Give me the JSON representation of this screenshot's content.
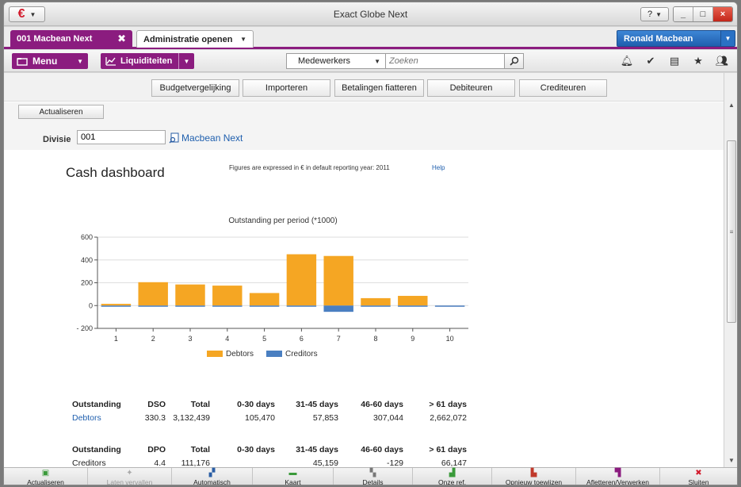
{
  "window": {
    "title": "Exact Globe Next",
    "help_label": "?",
    "controls": [
      "_",
      "□",
      "×"
    ]
  },
  "tabs": {
    "active_label": "001  Macbean Next",
    "second_label": "Administratie openen",
    "user_label": "Ronald Macbean"
  },
  "toolbar": {
    "menu_label": "Menu",
    "module_label": "Liquiditeiten",
    "search_scope": "Medewerkers",
    "search_placeholder": "Zoeken"
  },
  "topbuttons": [
    "Budgetvergelijking",
    "Importeren",
    "Betalingen fiatteren",
    "Debiteuren",
    "Crediteuren"
  ],
  "filter": {
    "refresh_label": "Actualiseren",
    "division_label": "Divisie",
    "division_value": "001",
    "division_link": "Macbean Next"
  },
  "dashboard": {
    "title": "Cash dashboard",
    "note": "Figures are expressed in € in default reporting year: 2011",
    "help": "Help"
  },
  "chart_data": {
    "type": "bar",
    "title": "Outstanding per period (*1000)",
    "categories": [
      "1",
      "2",
      "3",
      "4",
      "5",
      "6",
      "7",
      "8",
      "9",
      "10"
    ],
    "series": [
      {
        "name": "Debtors",
        "color": "#f5a623",
        "values": [
          15,
          205,
          185,
          175,
          110,
          450,
          435,
          65,
          85,
          0
        ]
      },
      {
        "name": "Creditors",
        "color": "#4a7fc1",
        "values": [
          -2,
          -2,
          -3,
          -3,
          -5,
          -10,
          -55,
          -10,
          -3,
          -3
        ]
      }
    ],
    "ylim": [
      -200,
      600
    ],
    "yticks": [
      "600",
      "400",
      "200",
      "0",
      "- 200"
    ],
    "grid": true,
    "legend": "bottom"
  },
  "stats": {
    "debtors_headers": [
      "Outstanding",
      "DSO",
      "Total",
      "0-30 days",
      "31-45 days",
      "46-60 days",
      "> 61 days"
    ],
    "debtors_row": [
      "Debtors",
      "330.3",
      "3,132,439",
      "105,470",
      "57,853",
      "307,044",
      "2,662,072"
    ],
    "creditors_headers": [
      "Outstanding",
      "DPO",
      "Total",
      "0-30 days",
      "31-45 days",
      "46-60 days",
      "> 61 days"
    ],
    "creditors_row": [
      "Creditors",
      "4.4",
      "111,176",
      "",
      "45,159",
      "-129",
      "66,147"
    ]
  },
  "bottombar": [
    {
      "label": "Actualiseren",
      "icon": "refresh-icon",
      "disabled": false
    },
    {
      "label": "Laten vervallen",
      "icon": "expire-icon",
      "disabled": true
    },
    {
      "label": "Automatisch",
      "icon": "auto-icon",
      "disabled": false
    },
    {
      "label": "Kaart",
      "icon": "card-icon",
      "disabled": false
    },
    {
      "label": "Details",
      "icon": "details-icon",
      "disabled": false
    },
    {
      "label": "Onze ref.",
      "icon": "ref-icon",
      "disabled": false
    },
    {
      "label": "Opnieuw toewijzen",
      "icon": "reassign-icon",
      "disabled": false
    },
    {
      "label": "Afletteren/Verwerken",
      "icon": "match-icon",
      "disabled": false
    },
    {
      "label": "Sluiten",
      "icon": "close-icon",
      "disabled": false
    }
  ]
}
